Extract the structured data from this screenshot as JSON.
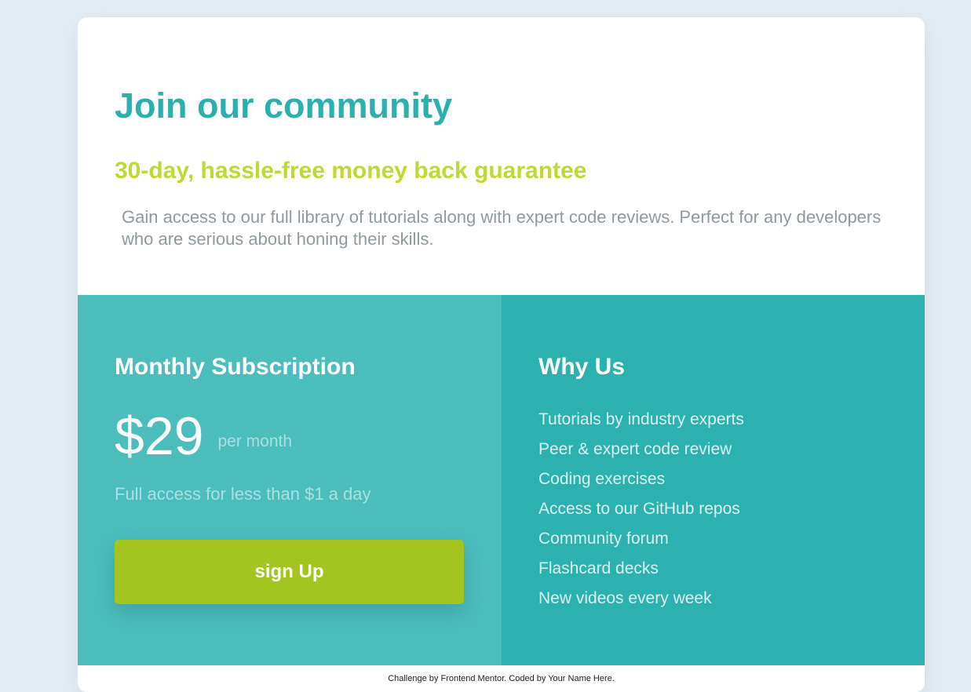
{
  "header": {
    "title": "Join our community",
    "guarantee": "30-day, hassle-free money back guarantee",
    "description": "Gain access to our full library of tutorials along with expert code reviews. Perfect for any developers who are serious about honing their skills."
  },
  "subscription": {
    "title": "Monthly Subscription",
    "price": "$29",
    "period": "per month",
    "tagline": "Full access for less than $1 a day",
    "button_label": "sign Up"
  },
  "why_us": {
    "title": "Why Us",
    "items": [
      "Tutorials by industry experts",
      "Peer & expert code review",
      "Coding exercises",
      "Access to our GitHub repos",
      "Community forum",
      "Flashcard decks",
      "New videos every week"
    ]
  },
  "footer": {
    "text": "Challenge by Frontend Mentor. Coded by Your Name Here."
  },
  "colors": {
    "page_bg": "#e4ecf3",
    "title": "#2bb0ae",
    "guarantee": "#bfd832",
    "left_panel": "#4bbdbc",
    "right_panel": "#2bb1af",
    "button": "#a4c420"
  }
}
